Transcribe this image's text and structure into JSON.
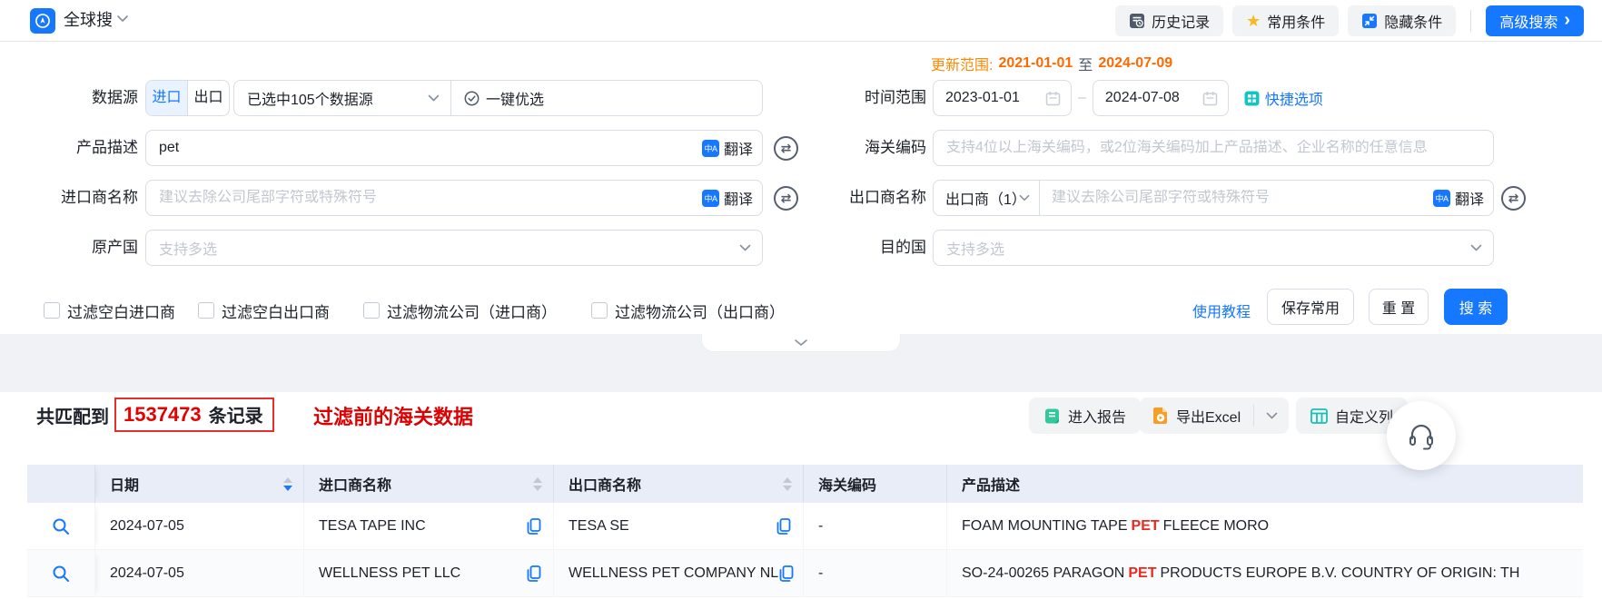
{
  "topbar": {
    "app_title": "全球搜",
    "history_btn": "历史记录",
    "favorites_btn": "常用条件",
    "hide_btn": "隐藏条件",
    "advanced_btn": "高级搜索"
  },
  "form": {
    "update_range": {
      "label": "更新范围:",
      "from": "2021-01-01",
      "mid": "至",
      "to": "2024-07-09"
    },
    "data_source": {
      "label": "数据源",
      "import_option": "进口",
      "export_option": "出口",
      "selected": "已选中105个数据源",
      "optimize": "一键优选"
    },
    "time_range": {
      "label": "时间范围",
      "from": "2023-01-01",
      "dash": "–",
      "to": "2024-07-08",
      "quick": "快捷选项"
    },
    "product_desc": {
      "label": "产品描述",
      "value": "pet",
      "translate": "翻译"
    },
    "hs_code": {
      "label": "海关编码",
      "placeholder": "支持4位以上海关编码，或2位海关编码加上产品描述、企业名称的任意信息"
    },
    "importer_name": {
      "label": "进口商名称",
      "placeholder": "建议去除公司尾部字符或特殊符号",
      "translate": "翻译"
    },
    "exporter_name": {
      "label": "出口商名称",
      "selector": "出口商（1）",
      "placeholder": "建议去除公司尾部字符或特殊符号",
      "translate": "翻译"
    },
    "origin_country": {
      "label": "原产国",
      "placeholder": "支持多选"
    },
    "dest_country": {
      "label": "目的国",
      "placeholder": "支持多选"
    },
    "filters": [
      "过滤空白进口商",
      "过滤空白出口商",
      "过滤物流公司（进口商）",
      "过滤物流公司（出口商）"
    ],
    "tutorial": "使用教程",
    "save": "保存常用",
    "reset": "重 置",
    "search": "搜 索"
  },
  "results": {
    "prefix": "共匹配到",
    "count": "1537473",
    "suffix": "条记录",
    "annotation": "过滤前的海关数据",
    "report_btn": "进入报告",
    "export_btn": "导出Excel",
    "custom_columns_btn": "自定义列"
  },
  "table": {
    "headers": {
      "date": "日期",
      "importer": "进口商名称",
      "exporter": "出口商名称",
      "hs": "海关编码",
      "desc": "产品描述"
    },
    "rows": [
      {
        "date": "2024-07-05",
        "importer": "TESA TAPE INC",
        "exporter": "TESA SE",
        "hs_code": "-",
        "desc_pre": "FOAM MOUNTING TAPE",
        "desc_hl": "PET",
        "desc_post": "FLEECE MORO"
      },
      {
        "date": "2024-07-05",
        "importer": "WELLNESS PET LLC",
        "exporter": "WELLNESS PET COMPANY NL",
        "hs_code": "-",
        "desc_pre": "SO-24-00265 PARAGON",
        "desc_hl": "PET",
        "desc_post": "PRODUCTS EUROPE B.V. COUNTRY OF ORIGIN: TH"
      }
    ]
  },
  "colors": {
    "accent": "#1677ff",
    "orange": "#ff6a00",
    "red": "#e60000",
    "table_header_bg": "#e9edf8"
  }
}
